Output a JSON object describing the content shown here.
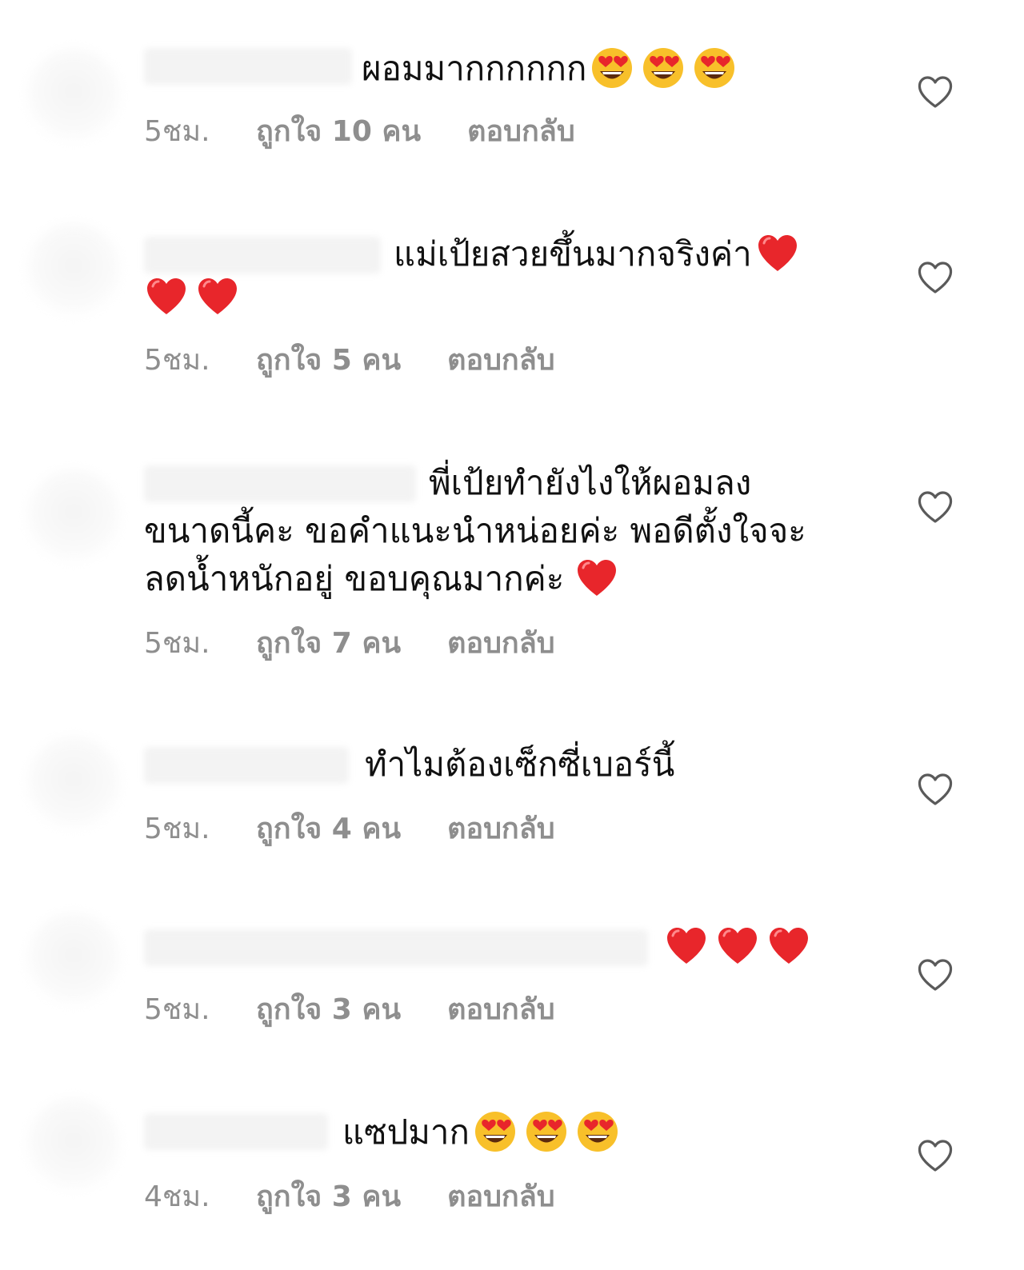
{
  "comments": [
    {
      "lines": [
        "ผอมมากกกกกก"
      ],
      "emojis": [
        "heart-eyes-icon",
        "heart-eyes-icon",
        "heart-eyes-icon"
      ],
      "time": "5ชม.",
      "likes": "ถูกใจ 10 คน",
      "reply": "ตอบกลับ"
    },
    {
      "lines": [
        "แม่เป้ยสวยขึ้นมากจริงค่า"
      ],
      "emojis": [
        "red-heart-icon",
        "red-heart-icon",
        "red-heart-icon"
      ],
      "time": "5ชม.",
      "likes": "ถูกใจ 5 คน",
      "reply": "ตอบกลับ"
    },
    {
      "lines": [
        "พี่เป้ยทำยังไงให้ผอมลง",
        "ขนาดนี้คะ ขอคำแนะนำหน่อยค่ะ พอดีตั้งใจจะ",
        "ลดน้ำหนักอยู่ ขอบคุณมากค่ะ"
      ],
      "emojis": [
        "red-heart-icon"
      ],
      "time": "5ชม.",
      "likes": "ถูกใจ 7 คน",
      "reply": "ตอบกลับ"
    },
    {
      "lines": [
        "ทำไมต้องเซ็กซี่เบอร์นี้"
      ],
      "emojis": [],
      "time": "5ชม.",
      "likes": "ถูกใจ 4 คน",
      "reply": "ตอบกลับ"
    },
    {
      "lines": [],
      "emojis": [
        "red-heart-icon",
        "red-heart-icon",
        "red-heart-icon"
      ],
      "time": "5ชม.",
      "likes": "ถูกใจ 3 คน",
      "reply": "ตอบกลับ"
    },
    {
      "lines": [
        "แซปมาก"
      ],
      "emojis": [
        "heart-eyes-icon",
        "heart-eyes-icon",
        "heart-eyes-icon"
      ],
      "time": "4ชม.",
      "likes": "ถูกใจ 3 คน",
      "reply": "ตอบกลับ"
    }
  ],
  "icons": {
    "like": "heart-outline-icon"
  },
  "colors": {
    "meta_text": "#8e8e8e",
    "comment_text": "#111111",
    "emoji_heart_red": "#e8262b",
    "emoji_face_yellow": "#f8c02a",
    "like_icon": "#5a5a5a"
  }
}
